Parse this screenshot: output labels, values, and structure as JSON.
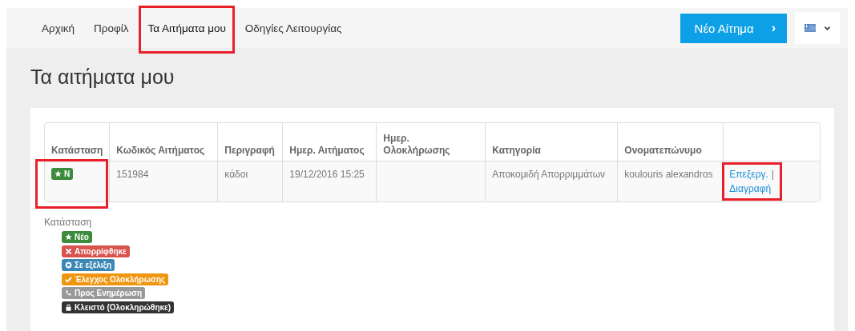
{
  "nav": {
    "items": [
      {
        "label": "Αρχική",
        "selected": false,
        "highlighted": false
      },
      {
        "label": "Προφίλ",
        "selected": false,
        "highlighted": false
      },
      {
        "label": "Τα Αιτήματα μου",
        "selected": true,
        "highlighted": true
      },
      {
        "label": "Οδηγίες Λειτουργίας",
        "selected": false,
        "highlighted": false
      }
    ],
    "new_request_button": {
      "label": "Νέο Αίτημα",
      "icon": "›"
    }
  },
  "page_title": "Τα αιτήματα μου",
  "table": {
    "columns": [
      "Κατάσταση",
      "Κωδικός Αιτήματος",
      "Περιγραφή",
      "Ημερ. Αιτήματος",
      "Ημερ. Ολοκλήρωσης",
      "Κατηγορία",
      "Ονοματεπώνυμο"
    ],
    "rows": [
      {
        "cells": [
          {
            "kind": "new",
            "label": "N",
            "color": "#3d8b3d",
            "highlighted": true
          },
          "151984",
          "κάδοι",
          "19/12/2016 15:25",
          "",
          "Αποκομιδή Απορριμμάτων",
          "koulouris alexandros"
        ],
        "actions": {
          "edit": "Επεξεργ.",
          "separator": "|",
          "delete": "Διαγραφή",
          "highlighted": true
        }
      }
    ]
  },
  "legend": {
    "title": "Κατάσταση",
    "items": [
      {
        "kind": "new",
        "label": "Νέο",
        "color": "#3d8b3d"
      },
      {
        "kind": "rejected",
        "label": "Απορρίφθηκε",
        "color": "#d9534f"
      },
      {
        "kind": "progress",
        "label": "Σε εξέλιξη",
        "color": "#3b87b5"
      },
      {
        "kind": "check",
        "label": "Έλεγχος Ολοκλήρωσης",
        "color": "#f0960e"
      },
      {
        "kind": "update",
        "label": "Προς Ενημέρωση",
        "color": "#999999"
      },
      {
        "kind": "closed",
        "label": "Κλειστό (Ολοκληρώθηκε)",
        "color": "#333333"
      }
    ]
  }
}
